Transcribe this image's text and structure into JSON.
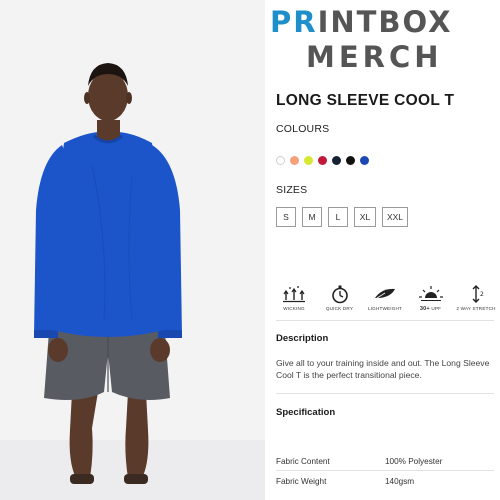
{
  "brand": {
    "line1_accent": "PR",
    "line1_rest": "INTBOX",
    "line2": "MERCH",
    "accent_color": "#1e8fc8"
  },
  "product": {
    "title": "LONG SLEEVE COOL T",
    "garment_color": "#1b55c9"
  },
  "colours": {
    "label": "COLOURS",
    "swatches": [
      "#ffffff",
      "#f4a07a",
      "#d6e830",
      "#c2183a",
      "#182033",
      "#111111",
      "#1d47b3"
    ]
  },
  "sizes": {
    "label": "SIZES",
    "options": [
      "S",
      "M",
      "L",
      "XL",
      "XXL"
    ]
  },
  "features": [
    {
      "icon": "wicking-icon",
      "label": "WICKING"
    },
    {
      "icon": "stopwatch-icon",
      "label": "QUICK DRY"
    },
    {
      "icon": "feather-icon",
      "label": "LIGHTWEIGHT"
    },
    {
      "icon": "sun-upf-icon",
      "label": "UPF",
      "badge": "30+"
    },
    {
      "icon": "stretch-icon",
      "label": "2 WAY STRETCH"
    }
  ],
  "description": {
    "heading": "Description",
    "text": "Give all to your training inside and out. The Long Sleeve Cool T is the perfect transitional piece."
  },
  "specification": {
    "heading": "Specification",
    "rows": [
      {
        "key": "Fabric Content",
        "value": "100% Polyester"
      },
      {
        "key": "Fabric Weight",
        "value": "140gsm"
      }
    ]
  }
}
